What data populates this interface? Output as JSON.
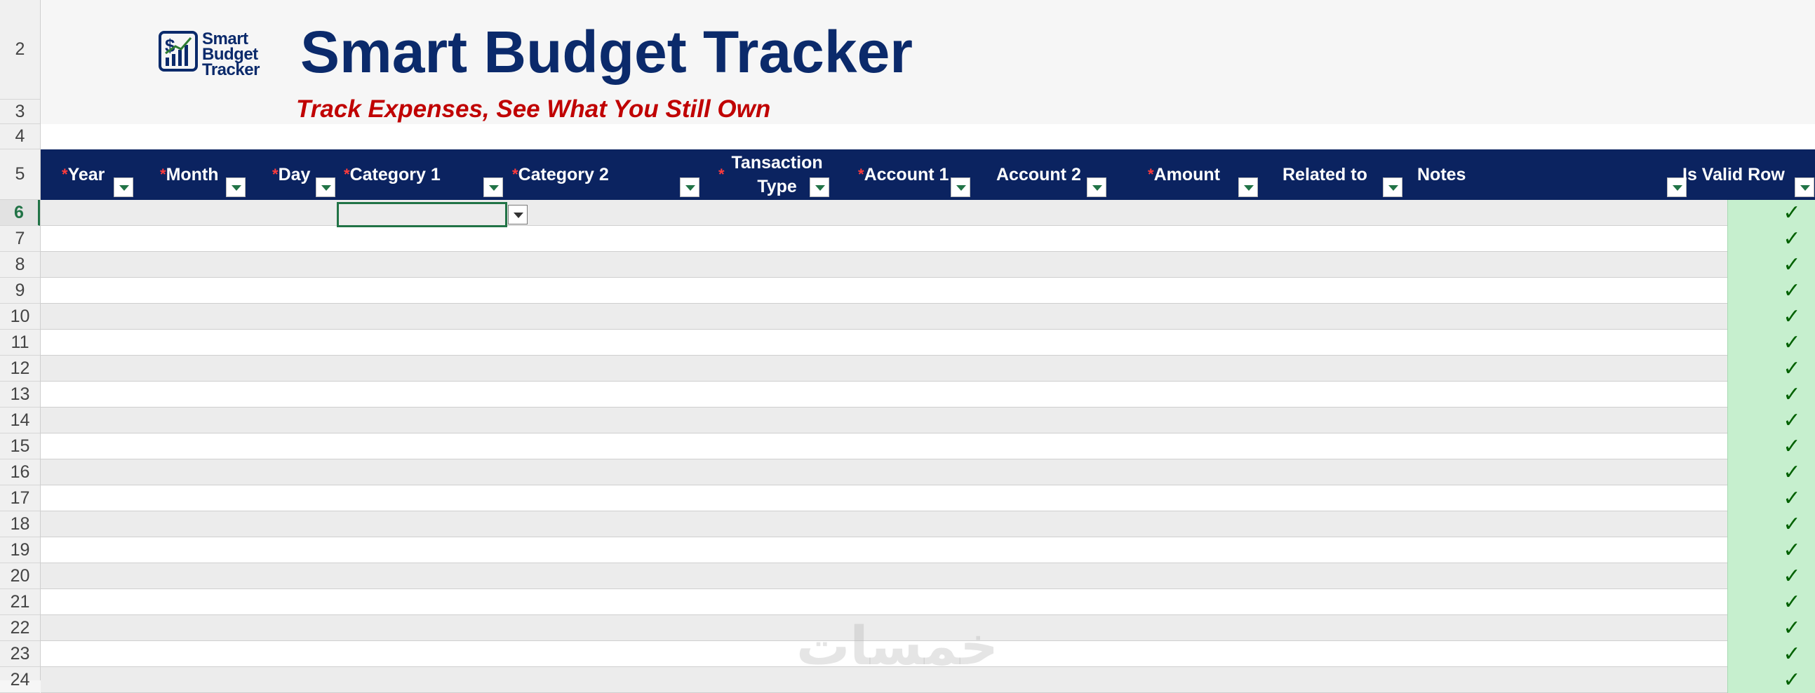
{
  "title": {
    "logo_lines": [
      "Smart",
      "Budget",
      "Tracker"
    ],
    "main": "Smart Budget Tracker",
    "subtitle": "Track Expenses, See What You Still Own"
  },
  "row_numbers": [
    "2",
    "3",
    "4",
    "5",
    "6",
    "7",
    "8",
    "9",
    "10",
    "11",
    "12",
    "13",
    "14",
    "15",
    "16",
    "17",
    "18",
    "19",
    "20",
    "21",
    "22",
    "23",
    "24"
  ],
  "active_row": "6",
  "required_marker": "*",
  "columns": [
    {
      "label": "Year",
      "required": true
    },
    {
      "label": "Month",
      "required": true
    },
    {
      "label": "Day",
      "required": true
    },
    {
      "label": "Category 1",
      "required": true
    },
    {
      "label": "Category 2",
      "required": true
    },
    {
      "label": "Tansaction Type",
      "required": true
    },
    {
      "label": "Account 1",
      "required": true
    },
    {
      "label": "Account 2",
      "required": false
    },
    {
      "label": "Amount",
      "required": true
    },
    {
      "label": "Related to",
      "required": false
    },
    {
      "label": "Notes",
      "required": false
    },
    {
      "label": "Is Valid Row",
      "required": false
    }
  ],
  "check_mark": "✓",
  "watermark": "خمسات",
  "colors": {
    "header_bg": "#0b2360",
    "title_color": "#0b2a6b",
    "subtitle_color": "#c00000",
    "valid_bg": "#c6efce",
    "valid_fg": "#006100",
    "selection": "#217346"
  }
}
